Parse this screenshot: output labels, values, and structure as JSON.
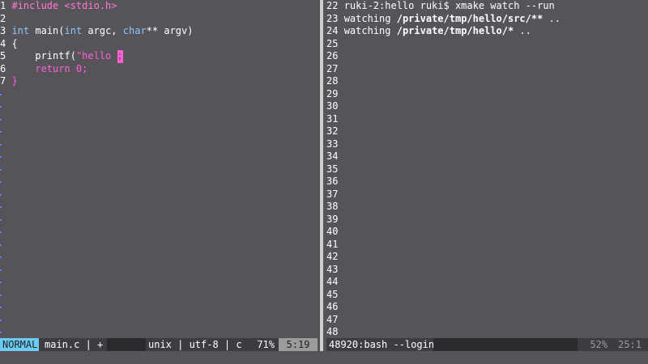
{
  "editor": {
    "lines": [
      {
        "num": "1",
        "parts": [
          {
            "t": "#include <stdio.h>",
            "c": "pp"
          }
        ]
      },
      {
        "num": "2",
        "parts": []
      },
      {
        "num": "3",
        "parts": [
          {
            "t": "int",
            "c": "kw"
          },
          {
            "t": " main(",
            "c": "fn"
          },
          {
            "t": "int",
            "c": "kw"
          },
          {
            "t": " argc, ",
            "c": "fn"
          },
          {
            "t": "char",
            "c": "kw"
          },
          {
            "t": "** argv)",
            "c": "fn"
          }
        ]
      },
      {
        "num": "4",
        "parts": [
          {
            "t": "{",
            "c": "fn"
          }
        ]
      },
      {
        "num": "5",
        "parts": [
          {
            "t": "    printf(",
            "c": "fn"
          },
          {
            "t": "\"hello ",
            "c": "str"
          }
        ]
      },
      {
        "num": "6",
        "parts": [
          {
            "t": "    ",
            "c": "fn"
          },
          {
            "t": "return 0;",
            "c": "str"
          }
        ]
      },
      {
        "num": "7",
        "parts": [
          {
            "t": "}",
            "c": "str"
          }
        ]
      }
    ],
    "cursor_char": ";"
  },
  "terminal": {
    "lines": [
      {
        "num": "22",
        "text": "ruki-2:hello ruki$ xmake watch --run",
        "bold": ""
      },
      {
        "num": "23",
        "text": "watching ",
        "bold": "/private/tmp/hello/src/**",
        "rest": " .."
      },
      {
        "num": "24",
        "text": "watching ",
        "bold": "/private/tmp/hello/*",
        "rest": " .."
      },
      {
        "num": "25"
      },
      {
        "num": "26"
      },
      {
        "num": "27"
      },
      {
        "num": "28"
      },
      {
        "num": "29"
      },
      {
        "num": "30"
      },
      {
        "num": "31"
      },
      {
        "num": "32"
      },
      {
        "num": "33"
      },
      {
        "num": "34"
      },
      {
        "num": "35"
      },
      {
        "num": "36"
      },
      {
        "num": "37"
      },
      {
        "num": "38"
      },
      {
        "num": "39"
      },
      {
        "num": "40"
      },
      {
        "num": "41"
      },
      {
        "num": "42"
      },
      {
        "num": "43"
      },
      {
        "num": "44"
      },
      {
        "num": "45"
      },
      {
        "num": "46"
      },
      {
        "num": "47"
      },
      {
        "num": "48"
      }
    ]
  },
  "status": {
    "mode": "NORMAL",
    "filename": "main.c | +",
    "fileinfo": "unix | utf-8 | c",
    "percent": "71%",
    "position": "5:19",
    "terminal_name": "48920:bash --login",
    "terminal_percent": "52%",
    "terminal_position": "25:1"
  },
  "colors": {
    "background": "#565458",
    "mode_bg": "#6ccbf3",
    "preprocessor": "#ff78d2",
    "keyword": "#8cc6ff",
    "tilde": "#5c7bff"
  }
}
